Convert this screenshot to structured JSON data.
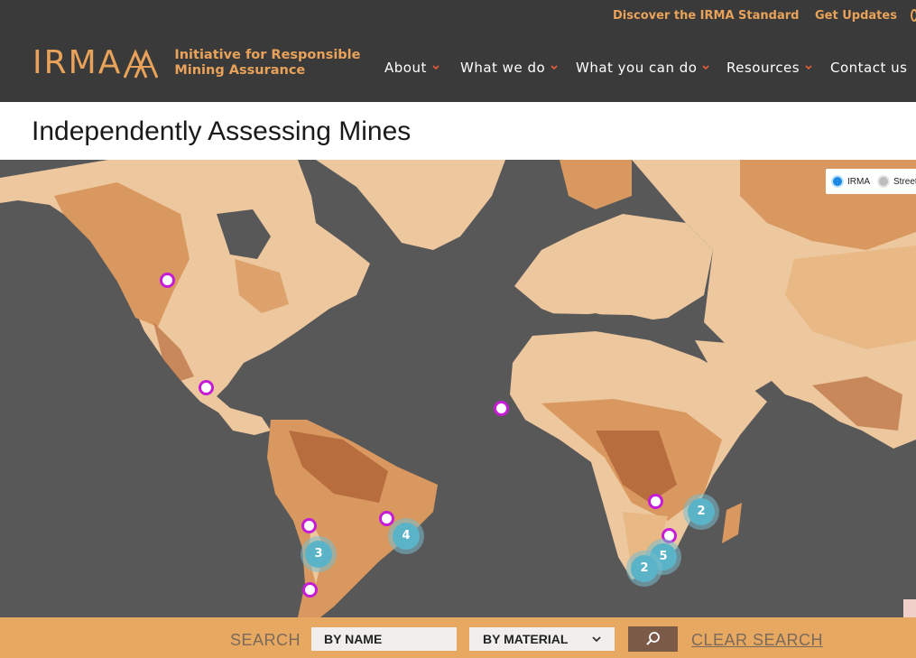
{
  "utility_nav": {
    "discover": "Discover the IRMA Standard",
    "updates": "Get Updates"
  },
  "logo": {
    "wordmark": "IRMA",
    "tagline_line1": "Initiative for Responsible",
    "tagline_line2": "Mining Assurance"
  },
  "nav": [
    {
      "label": "About",
      "has_dropdown": true
    },
    {
      "label": "What we do",
      "has_dropdown": true
    },
    {
      "label": "What you can do",
      "has_dropdown": true
    },
    {
      "label": "Resources",
      "has_dropdown": true
    },
    {
      "label": "Contact us",
      "has_dropdown": false
    }
  ],
  "page_title": "Independently Assessing Mines",
  "map": {
    "layers": [
      {
        "label": "IRMA",
        "selected": true
      },
      {
        "label": "Street",
        "selected": false
      }
    ],
    "clusters": [
      {
        "count": "2"
      },
      {
        "count": "5"
      },
      {
        "count": "2"
      },
      {
        "count": "3"
      },
      {
        "count": "4"
      }
    ],
    "colors": {
      "ocean": "#595859",
      "land_light": "#edc79e",
      "land_mid": "#d9985f",
      "land_dark": "#b86d3f",
      "pin_border": "#c61cd6",
      "cluster": "#5ab3c6"
    }
  },
  "search": {
    "label": "SEARCH",
    "name_placeholder": "BY NAME",
    "material_value": "BY MATERIAL",
    "button_icon": "search-icon",
    "clear_label": "CLEAR SEARCH"
  },
  "colors": {
    "header_bg": "#3a3a3a",
    "accent": "#e8a25a",
    "searchbar_bg": "#e7a862",
    "search_button": "#7b5a48"
  }
}
